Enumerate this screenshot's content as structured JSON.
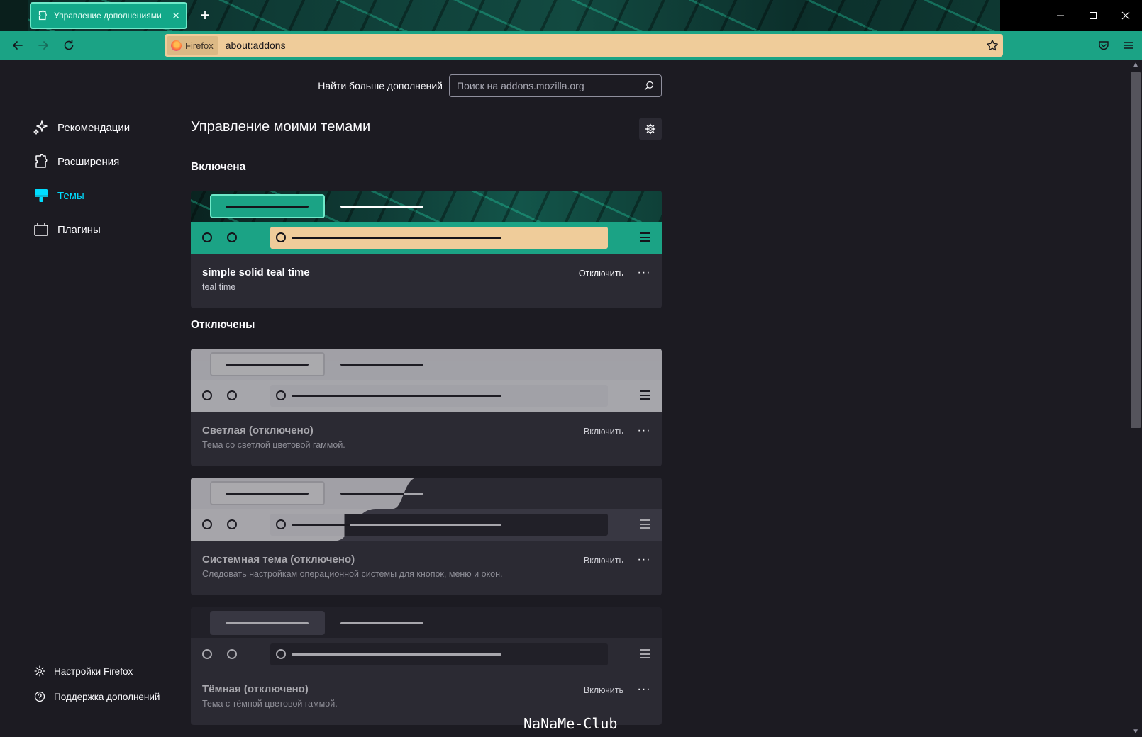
{
  "browser": {
    "tab_title": "Управление дополнениями",
    "identity_label": "Firefox",
    "url": "about:addons"
  },
  "sidebar": {
    "categories": [
      {
        "label": "Рекомендации",
        "icon": "sparkle-icon"
      },
      {
        "label": "Расширения",
        "icon": "puzzle-icon"
      },
      {
        "label": "Темы",
        "icon": "brush-icon",
        "active": true
      },
      {
        "label": "Плагины",
        "icon": "plugin-icon"
      }
    ],
    "footer": [
      {
        "label": "Настройки Firefox",
        "icon": "gear-icon"
      },
      {
        "label": "Поддержка дополнений",
        "icon": "help-icon"
      }
    ]
  },
  "main": {
    "search_label": "Найти больше дополнений",
    "search_placeholder": "Поиск на addons.mozilla.org",
    "title": "Управление моими темами",
    "enabled_heading": "Включена",
    "disabled_heading": "Отключены",
    "themes": [
      {
        "name": "simple solid teal time",
        "description": "teal time",
        "action": "Отключить",
        "enabled": true
      },
      {
        "name": "Светлая (отключено)",
        "description": "Тема со светлой цветовой гаммой.",
        "action": "Включить",
        "enabled": false
      },
      {
        "name": "Системная тема (отключено)",
        "description": "Следовать настройкам операционной системы для кнопок, меню и окон.",
        "action": "Включить",
        "enabled": false
      },
      {
        "name": "Тёмная (отключено)",
        "description": "Тема с тёмной цветовой гаммой.",
        "action": "Включить",
        "enabled": false
      }
    ],
    "more_label": "···"
  },
  "watermark": "NaNaMe-Club",
  "colors": {
    "accent_teal": "#1ba385",
    "urlbar": "#efcc9a",
    "page_bg": "#1c1b22",
    "card_bg": "#2b2a33",
    "active_link": "#00ddff"
  }
}
